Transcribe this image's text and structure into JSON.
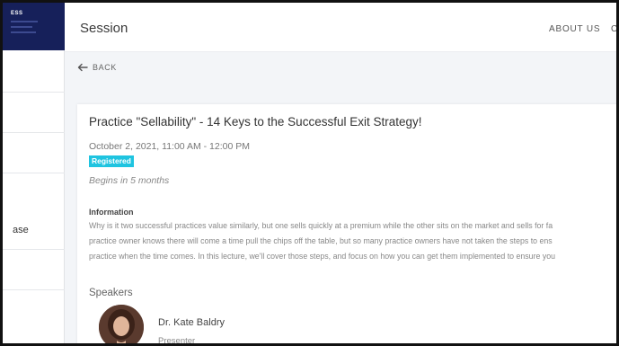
{
  "sidebar": {
    "logo_text": "ESS",
    "items": [
      {
        "label": ""
      },
      {
        "label": ""
      },
      {
        "label": ""
      },
      {
        "label": "ase"
      },
      {
        "label": ""
      }
    ]
  },
  "header": {
    "title": "Session",
    "nav": {
      "about": "ABOUT US",
      "more": "C"
    }
  },
  "back_label": "BACK",
  "event": {
    "title": "Practice \"Sellability\" - 14 Keys to the Successful Exit Strategy!",
    "date": "October 2, 2021, 11:00 AM - 12:00 PM",
    "status_badge": "Registered",
    "begins": "Begins in 5 months",
    "information_heading": "Information",
    "information_lines": [
      "Why is it two successful practices value similarly, but one sells quickly at a premium while the other sits on the market and sells for fa",
      "practice owner knows there will come a time pull the chips off the table, but so many practice owners have not taken the steps to ens",
      "practice when the time comes. In this lecture, we'll cover those steps, and focus on how you can get them implemented to ensure you"
    ],
    "speakers_heading": "Speakers",
    "speakers": [
      {
        "name": "Dr. Kate Baldry",
        "role": "Presenter"
      }
    ]
  },
  "colors": {
    "brand_dark": "#16205a",
    "badge": "#1fc4e0",
    "content_bg": "#f3f5f8"
  }
}
